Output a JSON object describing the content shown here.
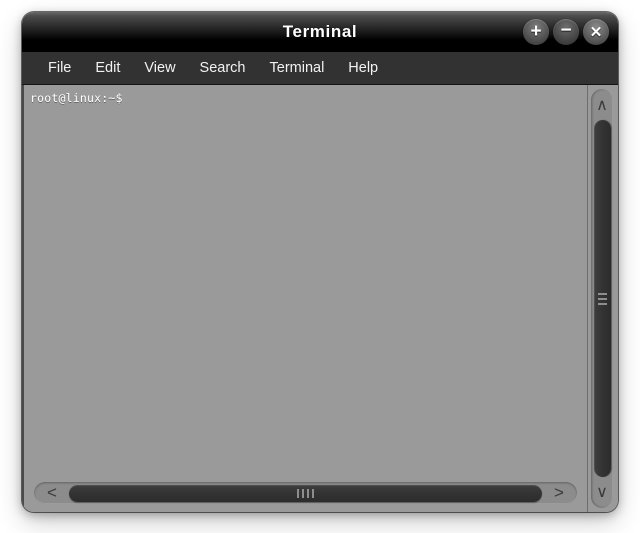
{
  "window": {
    "title": "Terminal",
    "controls": {
      "maximize_glyph": "+",
      "minimize_glyph": "−",
      "close_glyph": "✕",
      "maximize_name": "maximize",
      "minimize_name": "minimize",
      "close_name": "close"
    }
  },
  "menubar": {
    "items": [
      {
        "label": "File"
      },
      {
        "label": "Edit"
      },
      {
        "label": "View"
      },
      {
        "label": "Search"
      },
      {
        "label": "Terminal"
      },
      {
        "label": "Help"
      }
    ]
  },
  "terminal": {
    "lines": [
      "root@linux:~$"
    ],
    "prompt": "root@linux:~$",
    "background_color": "#9a9a9a",
    "text_color": "#ffffff"
  },
  "scrollbars": {
    "vertical": {
      "up_arrow_glyph": "∧",
      "down_arrow_glyph": "∨"
    },
    "horizontal": {
      "left_arrow_glyph": "<",
      "right_arrow_glyph": ">"
    }
  },
  "theme": {
    "titlebar_top": "#4b4b4b",
    "titlebar_bottom": "#000000",
    "menubar_bg": "#323232",
    "menu_text": "#f2f2f2",
    "window_bg": "#9a9a9a",
    "scroll_thumb": "#333333",
    "scroll_trough": "#8c8c8c",
    "page_bg": "#ffffff"
  }
}
